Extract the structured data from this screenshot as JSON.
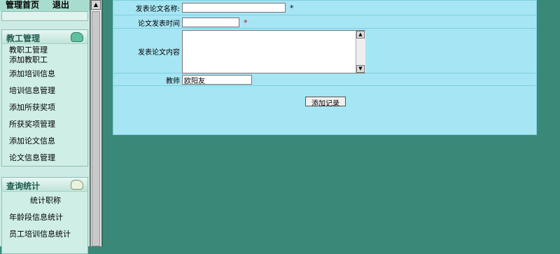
{
  "topnav": {
    "home": "管理首页",
    "logout": "退出"
  },
  "sidebar": {
    "sections": [
      {
        "title": "教工管理",
        "icon": "folder-icon",
        "items": [
          "教职工管理",
          "添加教职工",
          "添加培训信息",
          "培训信息管理",
          "添加所获奖项",
          "所获奖项管理",
          "添加论文信息",
          "论文信息管理"
        ]
      },
      {
        "title": "查询统计",
        "icon": "notepad-icon",
        "items": [
          "统计职称",
          "年龄段信息统计",
          "员工培训信息统计"
        ]
      }
    ]
  },
  "form": {
    "paper_name_label": "发表论文名称:",
    "paper_name_value": "",
    "required_star_1": "*",
    "paper_date_label": "论文发表时间",
    "paper_date_value": "",
    "required_star_2": "*",
    "paper_content_label": "发表论文内容",
    "paper_content_value": "",
    "teacher_label": "教师",
    "teacher_value": "欧阳友",
    "submit_label": "添加记录"
  },
  "colors": {
    "page_bg": "#3a8878",
    "form_bg": "#a6e6f4",
    "sidebar_bg": "#cdebe4",
    "required": "#cc0000"
  }
}
